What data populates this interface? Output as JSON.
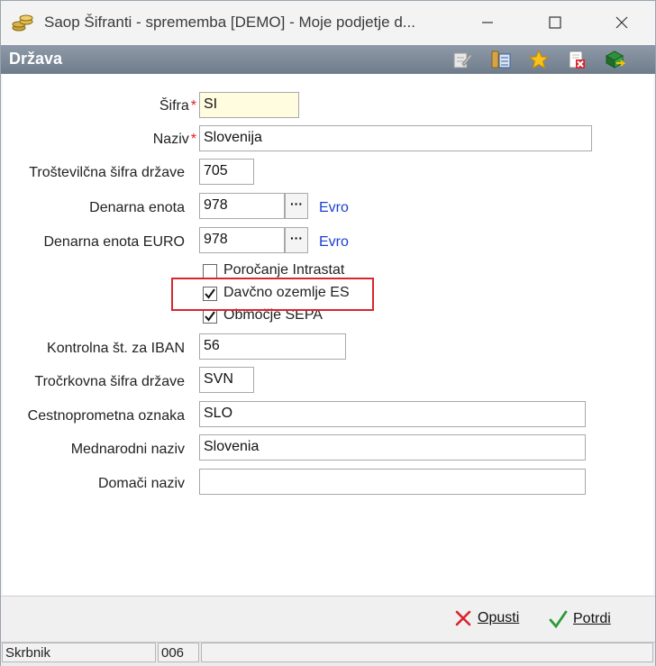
{
  "window": {
    "title": "Saop Šifranti - sprememba [DEMO] - Moje podjetje d...",
    "controls": [
      "minimize-icon",
      "maximize-icon",
      "close-icon"
    ]
  },
  "section": {
    "title": "Država",
    "toolbar_icons": [
      "edit-icon",
      "properties-icon",
      "favorite-star-icon",
      "delete-icon",
      "export-icon"
    ]
  },
  "form": {
    "sifra": {
      "label": "Šifra",
      "required_mark": "*",
      "value": "SI"
    },
    "naziv": {
      "label": "Naziv",
      "required_mark": "*",
      "value": "Slovenija"
    },
    "stevilcna_sifra": {
      "label": "Troštevilčna šifra države",
      "value": "705"
    },
    "denarna_enota": {
      "label": "Denarna enota",
      "value": "978",
      "browse": "···",
      "currency_name": "Evro"
    },
    "denarna_enota_euro": {
      "label": "Denarna enota EURO",
      "value": "978",
      "browse": "···",
      "currency_name": "Evro"
    },
    "porocanje_intrastat": {
      "label": "Poročanje Intrastat",
      "checked": false
    },
    "davcno_ozemlje": {
      "label": "Davčno ozemlje ES",
      "checked": true
    },
    "obmocje_sepa": {
      "label": "Območje SEPA",
      "checked": true
    },
    "kontrolna_iban": {
      "label": "Kontrolna št. za  IBAN",
      "value": "56"
    },
    "trocrkovna_sifra": {
      "label": "Tročrkovna šifra države",
      "value": "SVN"
    },
    "cestnoprometna": {
      "label": "Cestnoprometna oznaka",
      "value": "SLO"
    },
    "mednarodni_naziv": {
      "label": "Mednarodni naziv",
      "value": "Slovenia"
    },
    "domaci_naziv": {
      "label": "Domači naziv",
      "value": ""
    }
  },
  "footer": {
    "cancel_label": "Opusti",
    "confirm_label": "Potrdi"
  },
  "statusbar": {
    "user": "Skrbnik",
    "code": "006",
    "extra": ""
  },
  "colors": {
    "section_bar": "#7d8997",
    "highlight": "#d9262e",
    "link": "#1a3fd0",
    "required": "#d22222"
  }
}
